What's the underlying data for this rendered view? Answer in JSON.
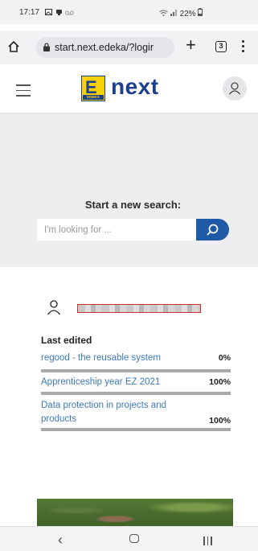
{
  "status_bar": {
    "time": "17:17",
    "notification_icons": [
      "image-icon",
      "notification-icon",
      "voicemail-icon"
    ],
    "battery": "22%",
    "signal_icons": [
      "wifi-icon",
      "signal-icon",
      "battery-icon"
    ]
  },
  "browser": {
    "url": "start.next.edeka/?logir",
    "tab_count": "3",
    "icons": [
      "home-icon",
      "lock-icon",
      "plus-icon",
      "tabs-icon",
      "more-vert-icon"
    ]
  },
  "header": {
    "logo_text": "next",
    "logo_badge": "EDEKA",
    "icons": [
      "hamburger-menu-icon",
      "user-avatar-icon"
    ]
  },
  "search": {
    "title": "Start a new search:",
    "placeholder": "I'm looking for ...",
    "button_icon": "search-icon"
  },
  "last_edited": {
    "heading": "Last edited",
    "items": [
      {
        "label": "regood - the reusable system",
        "progress": "0%",
        "fill": 0
      },
      {
        "label": "Apprenticeship year EZ 2021",
        "progress": "100%",
        "fill": 1
      },
      {
        "label": "Data protection in projects and products",
        "progress": "100%",
        "fill": 1
      }
    ]
  },
  "colors": {
    "brand_blue": "#1e5aa6",
    "logo_yellow": "#f7d10a",
    "link_blue": "#3d79b9",
    "panel_grey": "#eeeef0"
  }
}
